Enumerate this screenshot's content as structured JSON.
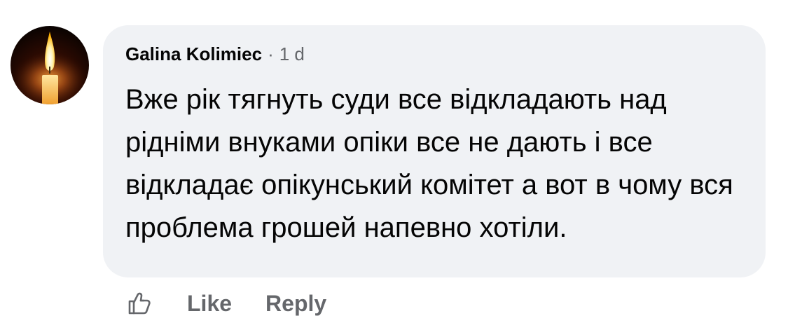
{
  "comment": {
    "author": "Galina Kolimiec",
    "separator": "·",
    "timestamp": "1 d",
    "text": "Вже рік тягнуть суди все відкладають над рідніми внуками опіки все не дають і все відкладає опікунський комітет а вот в чому вся проблема грошей напевно хотіли.",
    "avatar_icon": "candle-avatar",
    "bubble_color": "#f0f2f5"
  },
  "actions": {
    "react_icon": "thumbs-up-outline-icon",
    "like_label": "Like",
    "reply_label": "Reply"
  }
}
